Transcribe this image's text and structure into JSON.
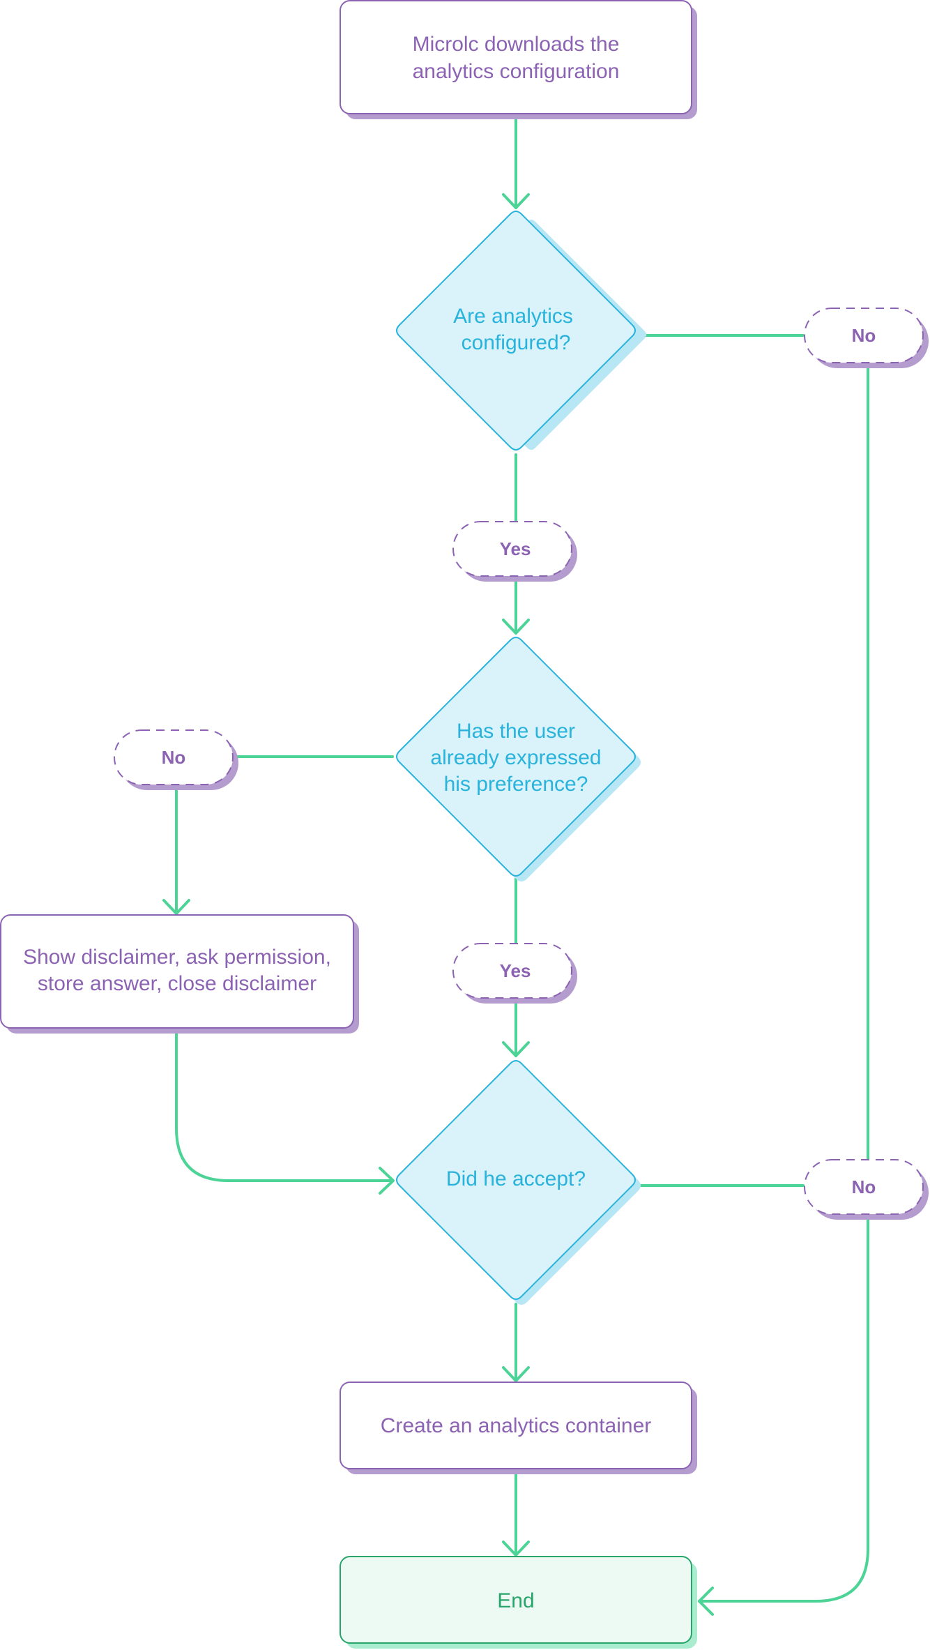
{
  "diagram": {
    "type": "flowchart",
    "colors": {
      "process_border": "#8c63b3",
      "process_shadow": "#b59ccf",
      "process_text": "#8c63b3",
      "decision_fill": "#daf3fa",
      "decision_border": "#29b3dc",
      "decision_shadow": "#b7e6f5",
      "decision_text": "#29b3dc",
      "label_border": "#8c63b3",
      "label_shadow": "#b59ccf",
      "label_text": "#8c63b3",
      "end_fill": "#edfaf4",
      "end_border": "#27a56a",
      "end_shadow": "#aaecd0",
      "end_text": "#27a56a",
      "edge": "#4cd396"
    },
    "nodes": [
      {
        "id": "download",
        "kind": "process",
        "lines": [
          "Microlc downloads the",
          "analytics configuration"
        ]
      },
      {
        "id": "configured",
        "kind": "decision",
        "lines": [
          "Are analytics",
          "configured?"
        ]
      },
      {
        "id": "pref",
        "kind": "decision",
        "lines": [
          "Has the user",
          "already expressed",
          "his preference?"
        ]
      },
      {
        "id": "disclaimer",
        "kind": "process",
        "lines": [
          "Show disclaimer, ask permission,",
          "store answer, close disclaimer"
        ]
      },
      {
        "id": "accept",
        "kind": "decision",
        "lines": [
          "Did he accept?"
        ]
      },
      {
        "id": "create",
        "kind": "process",
        "lines": [
          "Create an analytics container"
        ]
      },
      {
        "id": "end",
        "kind": "terminal",
        "lines": [
          "End"
        ]
      }
    ],
    "edge_labels": [
      {
        "id": "configured-no",
        "text": "No"
      },
      {
        "id": "configured-yes",
        "text": "Yes"
      },
      {
        "id": "pref-no",
        "text": "No"
      },
      {
        "id": "pref-yes",
        "text": "Yes"
      },
      {
        "id": "accept-no",
        "text": "No"
      }
    ],
    "edges": [
      {
        "from": "download",
        "to": "configured",
        "label": ""
      },
      {
        "from": "configured",
        "to": "pref",
        "label": "Yes"
      },
      {
        "from": "configured",
        "to": "end",
        "label": "No"
      },
      {
        "from": "pref",
        "to": "disclaimer",
        "label": "No"
      },
      {
        "from": "pref",
        "to": "accept",
        "label": "Yes"
      },
      {
        "from": "disclaimer",
        "to": "accept",
        "label": ""
      },
      {
        "from": "accept",
        "to": "create",
        "label": ""
      },
      {
        "from": "accept",
        "to": "end",
        "label": "No"
      },
      {
        "from": "create",
        "to": "end",
        "label": ""
      }
    ]
  }
}
